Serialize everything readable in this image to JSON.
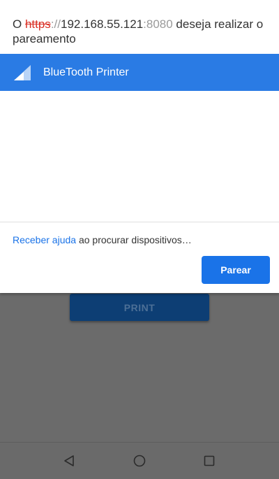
{
  "dialog": {
    "title": {
      "prefix": "O ",
      "scheme": "https",
      "separator": "://",
      "host": "192.168.55.121",
      "port": ":8080",
      "suffix": " deseja realizar o pareamento"
    },
    "devices": [
      {
        "name": "BlueTooth Printer",
        "icon": "signal-strength-icon",
        "selected": true
      }
    ],
    "help": {
      "link_text": "Receber ajuda",
      "rest_text": " ao procurar dispositivos…"
    },
    "pair_label": "Parear"
  },
  "background_app": {
    "print_label": "PRINT"
  },
  "nav_bar": {
    "back_icon": "back-triangle-icon",
    "home_icon": "home-circle-icon",
    "recents_icon": "recents-square-icon"
  },
  "colors": {
    "accent": "#1a73e8",
    "selected_row": "#2a7be4",
    "insecure_scheme": "#d93025",
    "overlay": "#6b6b6b"
  }
}
